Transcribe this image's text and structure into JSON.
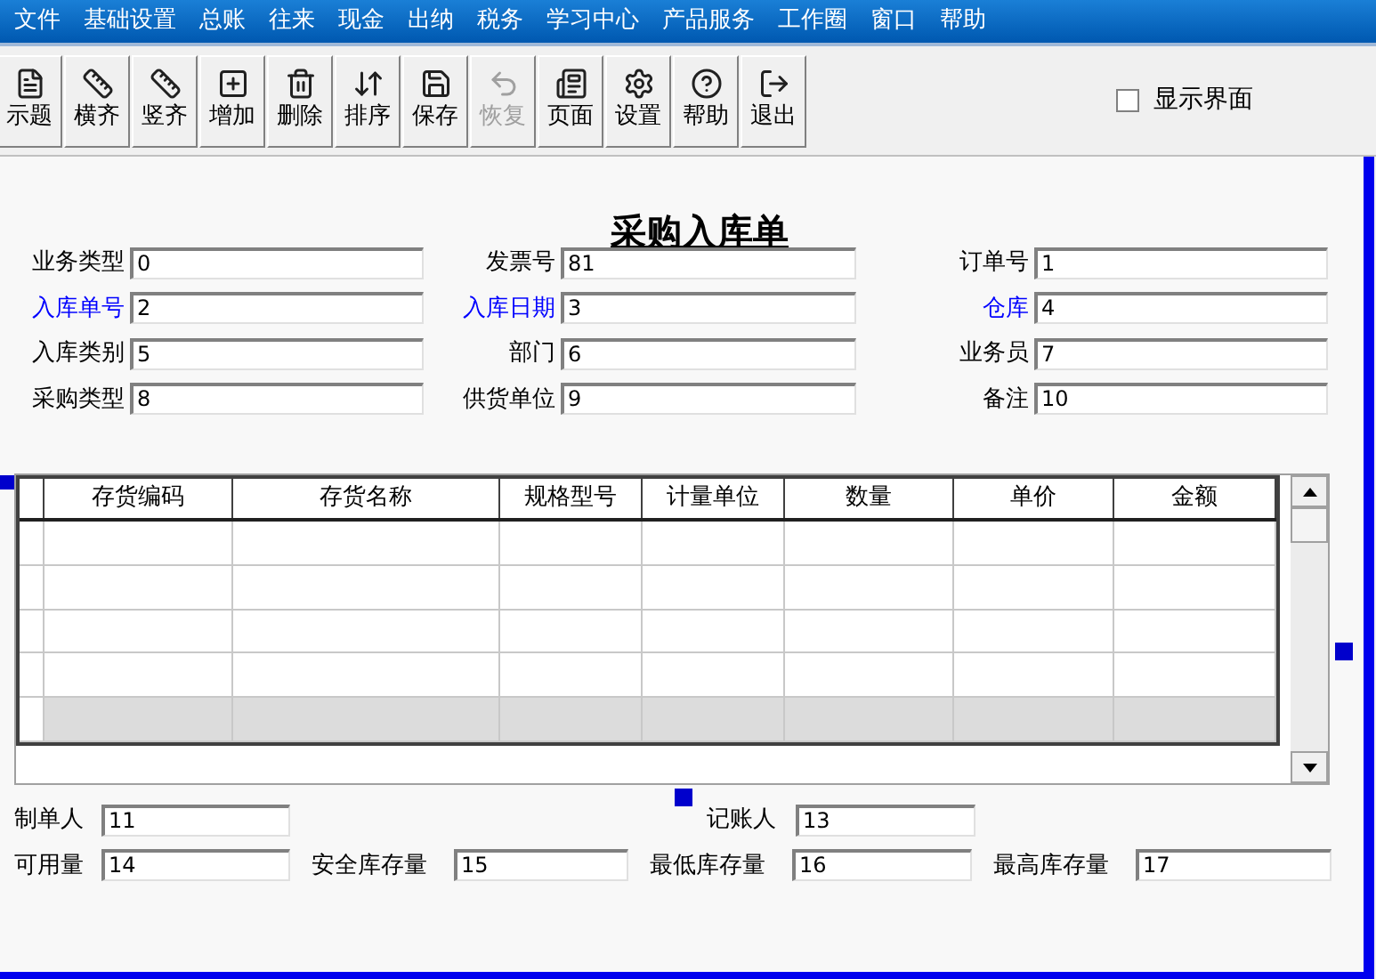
{
  "menu": [
    "文件",
    "基础设置",
    "总账",
    "往来",
    "现金",
    "出纳",
    "税务",
    "学习中心",
    "产品服务",
    "工作圈",
    "窗口",
    "帮助"
  ],
  "toolbar": [
    {
      "label": "示题",
      "kind": "title",
      "disabled": false
    },
    {
      "label": "横齐",
      "kind": "hruler",
      "disabled": false
    },
    {
      "label": "竖齐",
      "kind": "vruler",
      "disabled": false
    },
    {
      "label": "增加",
      "kind": "add",
      "disabled": false
    },
    {
      "label": "删除",
      "kind": "delete",
      "disabled": false
    },
    {
      "label": "排序",
      "kind": "tab",
      "disabled": false
    },
    {
      "label": "保存",
      "kind": "save",
      "disabled": false
    },
    {
      "label": "恢复",
      "kind": "restore",
      "disabled": true
    },
    {
      "label": "页面",
      "kind": "page",
      "disabled": false
    },
    {
      "label": "设置",
      "kind": "settings",
      "disabled": false
    },
    {
      "label": "帮助",
      "kind": "help",
      "disabled": false
    },
    {
      "label": "退出",
      "kind": "exit",
      "disabled": false
    }
  ],
  "show_interface": {
    "label": "显示界面",
    "checked": false
  },
  "form": {
    "title": "采购入库单",
    "header_rows": [
      [
        {
          "label": "业务类型",
          "value": "0",
          "highlighted": false
        },
        {
          "label": "发票号",
          "value": "81",
          "highlighted": false
        },
        {
          "label": "订单号",
          "value": "1",
          "highlighted": false
        }
      ],
      [
        {
          "label": "入库单号",
          "value": "2",
          "highlighted": true
        },
        {
          "label": "入库日期",
          "value": "3",
          "highlighted": true
        },
        {
          "label": "仓库",
          "value": "4",
          "highlighted": true
        }
      ],
      [
        {
          "label": "入库类别",
          "value": "5",
          "highlighted": false
        },
        {
          "label": "部门",
          "value": "6",
          "highlighted": false
        },
        {
          "label": "业务员",
          "value": "7",
          "highlighted": false
        }
      ],
      [
        {
          "label": "采购类型",
          "value": "8",
          "highlighted": false
        },
        {
          "label": "供货单位",
          "value": "9",
          "highlighted": false
        },
        {
          "label": "备注",
          "value": "10",
          "highlighted": false
        }
      ]
    ],
    "table": {
      "columns": [
        "存货编码",
        "存货名称",
        "规格型号",
        "计量单位",
        "数量",
        "单价",
        "金额"
      ],
      "rows": [
        {
          "selected": false
        },
        {
          "selected": false
        },
        {
          "selected": false
        },
        {
          "selected": false
        },
        {
          "selected": true
        }
      ]
    },
    "footer": {
      "maker": {
        "label": "制单人",
        "value": "11"
      },
      "bookkeeper": {
        "label": "记账人",
        "value": "13"
      },
      "stock": [
        {
          "label": "可用量",
          "value": "14"
        },
        {
          "label": "安全库存量",
          "value": "15"
        },
        {
          "label": "最低库存量",
          "value": "16"
        },
        {
          "label": "最高库存量",
          "value": "17"
        }
      ]
    }
  }
}
